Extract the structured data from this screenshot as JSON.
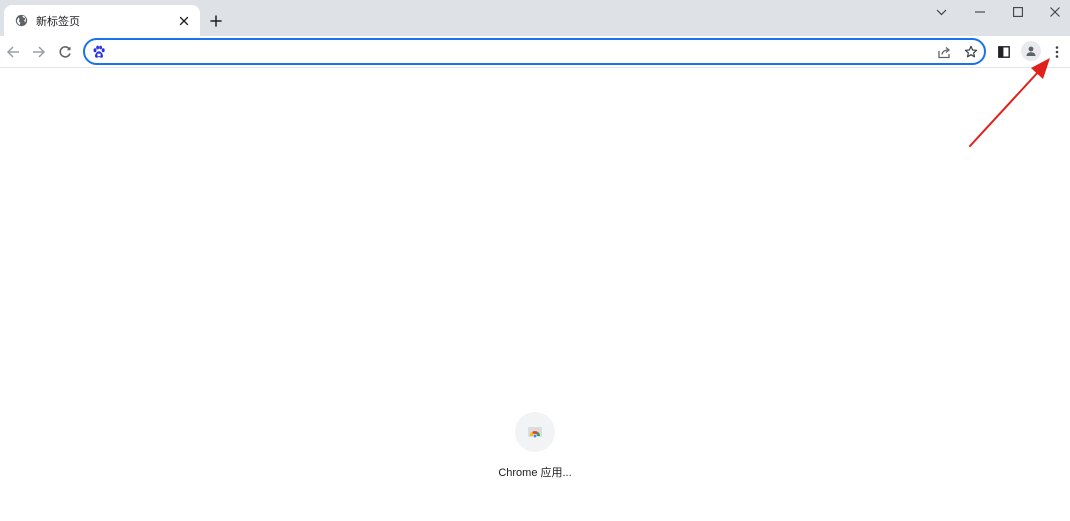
{
  "tab": {
    "title": "新标签页"
  },
  "omnibox": {
    "value": "",
    "placeholder": ""
  },
  "shortcuts": [
    {
      "label": "Chrome 应用..."
    }
  ],
  "colors": {
    "accent": "#1a73e8",
    "tabstrip": "#dee1e6",
    "annotation_arrow": "#e0201a"
  },
  "icons": {
    "tab_favicon": "globe-icon",
    "tab_close": "close-icon",
    "new_tab": "plus-icon",
    "search_engine": "baidu-paw-icon",
    "share": "share-icon",
    "bookmark": "star-icon",
    "side_panel": "side-panel-icon",
    "profile": "profile-avatar-icon",
    "menu": "kebab-menu-icon"
  }
}
